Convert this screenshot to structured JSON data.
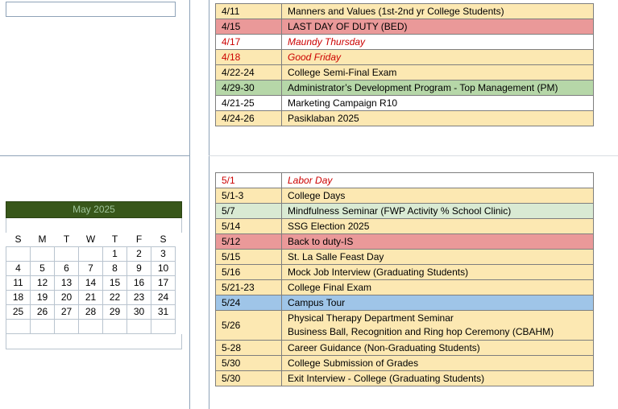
{
  "april": [
    {
      "date": "4/11",
      "event": "Manners and Values (1st-2nd yr College Students)",
      "bg": "#fce8b2",
      "date_color": "#000000",
      "event_color": "#000000",
      "italic": false
    },
    {
      "date": "4/15",
      "event": "LAST DAY OF DUTY (BED)",
      "bg": "#ea9999",
      "date_color": "#000000",
      "event_color": "#000000",
      "italic": false
    },
    {
      "date": "4/17",
      "event": "Maundy Thursday",
      "bg": "#ffffff",
      "date_color": "#cc0000",
      "event_color": "#cc0000",
      "italic": true
    },
    {
      "date": "4/18",
      "event": "Good Friday",
      "bg": "#fce8b2",
      "date_color": "#cc0000",
      "event_color": "#cc0000",
      "italic": true
    },
    {
      "date": "4/22-24",
      "event": "College Semi-Final Exam",
      "bg": "#fce8b2",
      "date_color": "#000000",
      "event_color": "#000000",
      "italic": false
    },
    {
      "date": "4/29-30",
      "event": "Administrator’s Development Program - Top Management (PM)",
      "bg": "#b6d7a8",
      "date_color": "#000000",
      "event_color": "#000000",
      "italic": false
    },
    {
      "date": "4/21-25",
      "event": "Marketing Campaign R10",
      "bg": "#ffffff",
      "date_color": "#000000",
      "event_color": "#000000",
      "italic": false
    },
    {
      "date": "4/24-26",
      "event": "Pasiklaban 2025",
      "bg": "#fce8b2",
      "date_color": "#000000",
      "event_color": "#000000",
      "italic": false
    }
  ],
  "may": [
    {
      "date": "5/1",
      "event": "Labor Day",
      "bg": "#ffffff",
      "date_color": "#cc0000",
      "event_color": "#cc0000",
      "italic": true
    },
    {
      "date": "5/1-3",
      "event": "College Days",
      "bg": "#fce8b2",
      "date_color": "#000000",
      "event_color": "#000000",
      "italic": false
    },
    {
      "date": "5/7",
      "event": "Mindfulness Seminar (FWP Activity % School Clinic)",
      "bg": "#d9ead3",
      "date_color": "#000000",
      "event_color": "#000000",
      "italic": false
    },
    {
      "date": "5/14",
      "event": "SSG Election 2025",
      "bg": "#fce8b2",
      "date_color": "#000000",
      "event_color": "#000000",
      "italic": false
    },
    {
      "date": "5/12",
      "event": "Back to duty-IS",
      "bg": "#ea9999",
      "date_color": "#000000",
      "event_color": "#000000",
      "italic": false
    },
    {
      "date": "5/15",
      "event": "St. La Salle Feast Day",
      "bg": "#fce8b2",
      "date_color": "#000000",
      "event_color": "#000000",
      "italic": false
    },
    {
      "date": "5/16",
      "event": "Mock Job Interview (Graduating Students)",
      "bg": "#fce8b2",
      "date_color": "#000000",
      "event_color": "#000000",
      "italic": false
    },
    {
      "date": "5/21-23",
      "event": "College Final Exam",
      "bg": "#fce8b2",
      "date_color": "#000000",
      "event_color": "#000000",
      "italic": false
    },
    {
      "date": "5/24",
      "event": "Campus Tour",
      "bg": "#9fc5e8",
      "date_color": "#000000",
      "event_color": "#000000",
      "italic": false
    },
    {
      "date": "5/26",
      "event": "Physical Therapy Department Seminar",
      "event2": "Business Ball, Recognition and Ring hop Ceremony (CBAHM)",
      "bg": "#fce8b2",
      "date_color": "#000000",
      "event_color": "#000000",
      "italic": false
    },
    {
      "date": "5-28",
      "event": "Career Guidance (Non-Graduating Students)",
      "bg": "#fce8b2",
      "date_color": "#000000",
      "event_color": "#000000",
      "italic": false
    },
    {
      "date": "5/30",
      "event": "College Submission of Grades",
      "bg": "#fce8b2",
      "date_color": "#000000",
      "event_color": "#000000",
      "italic": false
    },
    {
      "date": "5/30",
      "event": "Exit Interview - College (Graduating Students)",
      "bg": "#fce8b2",
      "date_color": "#000000",
      "event_color": "#000000",
      "italic": false
    }
  ],
  "calendar": {
    "title": "May 2025",
    "header_bg": "#38571a",
    "weekdays": [
      "S",
      "M",
      "T",
      "W",
      "T",
      "F",
      "S"
    ],
    "weeks": [
      [
        "",
        "",
        "",
        "",
        "1",
        "2",
        "3"
      ],
      [
        "4",
        "5",
        "6",
        "7",
        "8",
        "9",
        "10"
      ],
      [
        "11",
        "12",
        "13",
        "14",
        "15",
        "16",
        "17"
      ],
      [
        "18",
        "19",
        "20",
        "21",
        "22",
        "23",
        "24"
      ],
      [
        "25",
        "26",
        "27",
        "28",
        "29",
        "30",
        "31"
      ],
      [
        "",
        "",
        "",
        "",
        "",
        "",
        ""
      ]
    ]
  }
}
